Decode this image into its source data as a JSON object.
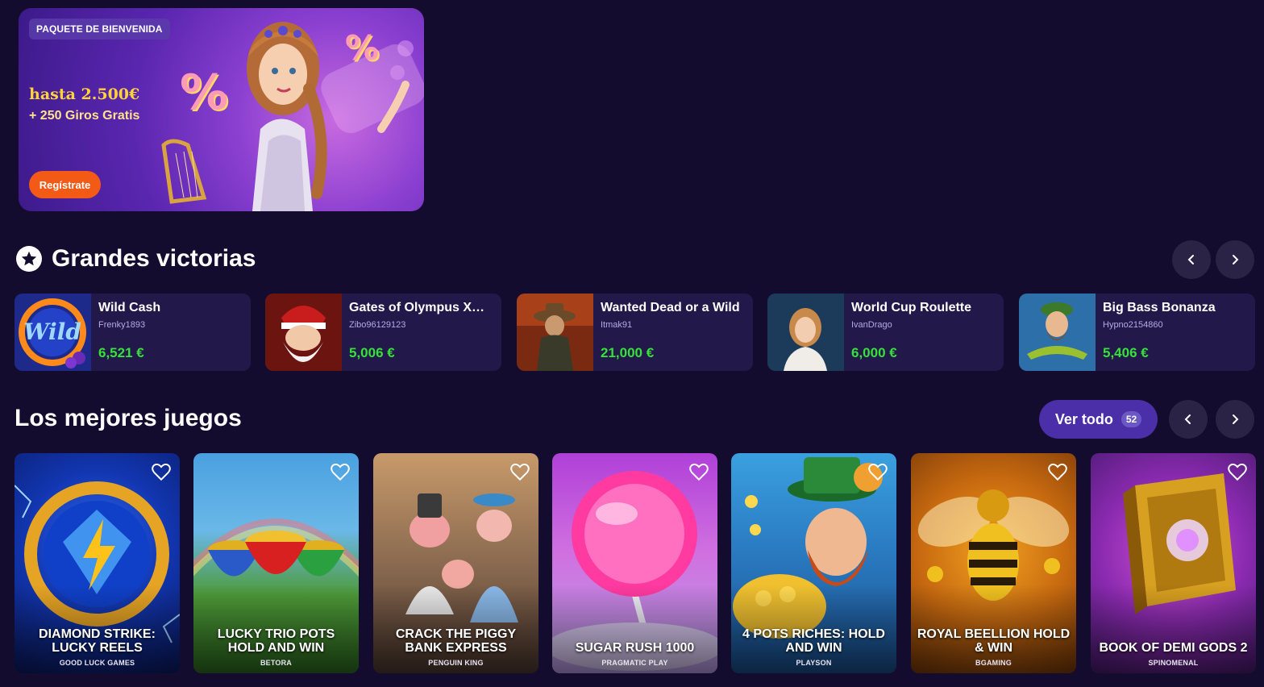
{
  "banner": {
    "badge": "PAQUETE DE BIENVENIDA",
    "amount": "hasta 2.500€",
    "spins": "+ 250 Giros Gratis",
    "cta": "Regístrate",
    "percent_symbol": "%"
  },
  "big_wins": {
    "title": "Grandes victorias",
    "icon": "star-icon",
    "items": [
      {
        "game": "Wild Cash",
        "user": "Frenky1893",
        "amount": "6,521 €"
      },
      {
        "game": "Gates of Olympus Xma...",
        "user": "Zibo96129123",
        "amount": "5,006 €"
      },
      {
        "game": "Wanted Dead or a Wild",
        "user": "Itmak91",
        "amount": "21,000 €"
      },
      {
        "game": "World Cup Roulette",
        "user": "IvanDrago",
        "amount": "6,000 €"
      },
      {
        "game": "Big Bass Bonanza",
        "user": "Hypno2154860",
        "amount": "5,406 €"
      }
    ]
  },
  "top_games": {
    "title": "Los mejores juegos",
    "view_all": "Ver todo",
    "count": "52",
    "items": [
      {
        "name": "DIAMOND STRIKE: LUCKY REELS",
        "provider": "GOOD LUCK GAMES"
      },
      {
        "name": "LUCKY TRIO POTS HOLD AND WIN",
        "provider": "BETORA"
      },
      {
        "name": "CRACK THE PIGGY BANK EXPRESS",
        "provider": "PENGUIN KING"
      },
      {
        "name": "SUGAR RUSH 1000",
        "provider": "PRAGMATIC PLAY"
      },
      {
        "name": "4 POTS RICHES: HOLD AND WIN",
        "provider": "PLAYSON"
      },
      {
        "name": "ROYAL BEELLION HOLD & WIN",
        "provider": "BGAMING"
      },
      {
        "name": "BOOK OF DEMI GODS 2",
        "provider": "SPINOMENAL"
      }
    ]
  },
  "colors": {
    "background": "#140c2e",
    "card": "#22194a",
    "win_amount": "#37e03a",
    "cta": "#f25a16",
    "accent": "#4a2fa8"
  }
}
